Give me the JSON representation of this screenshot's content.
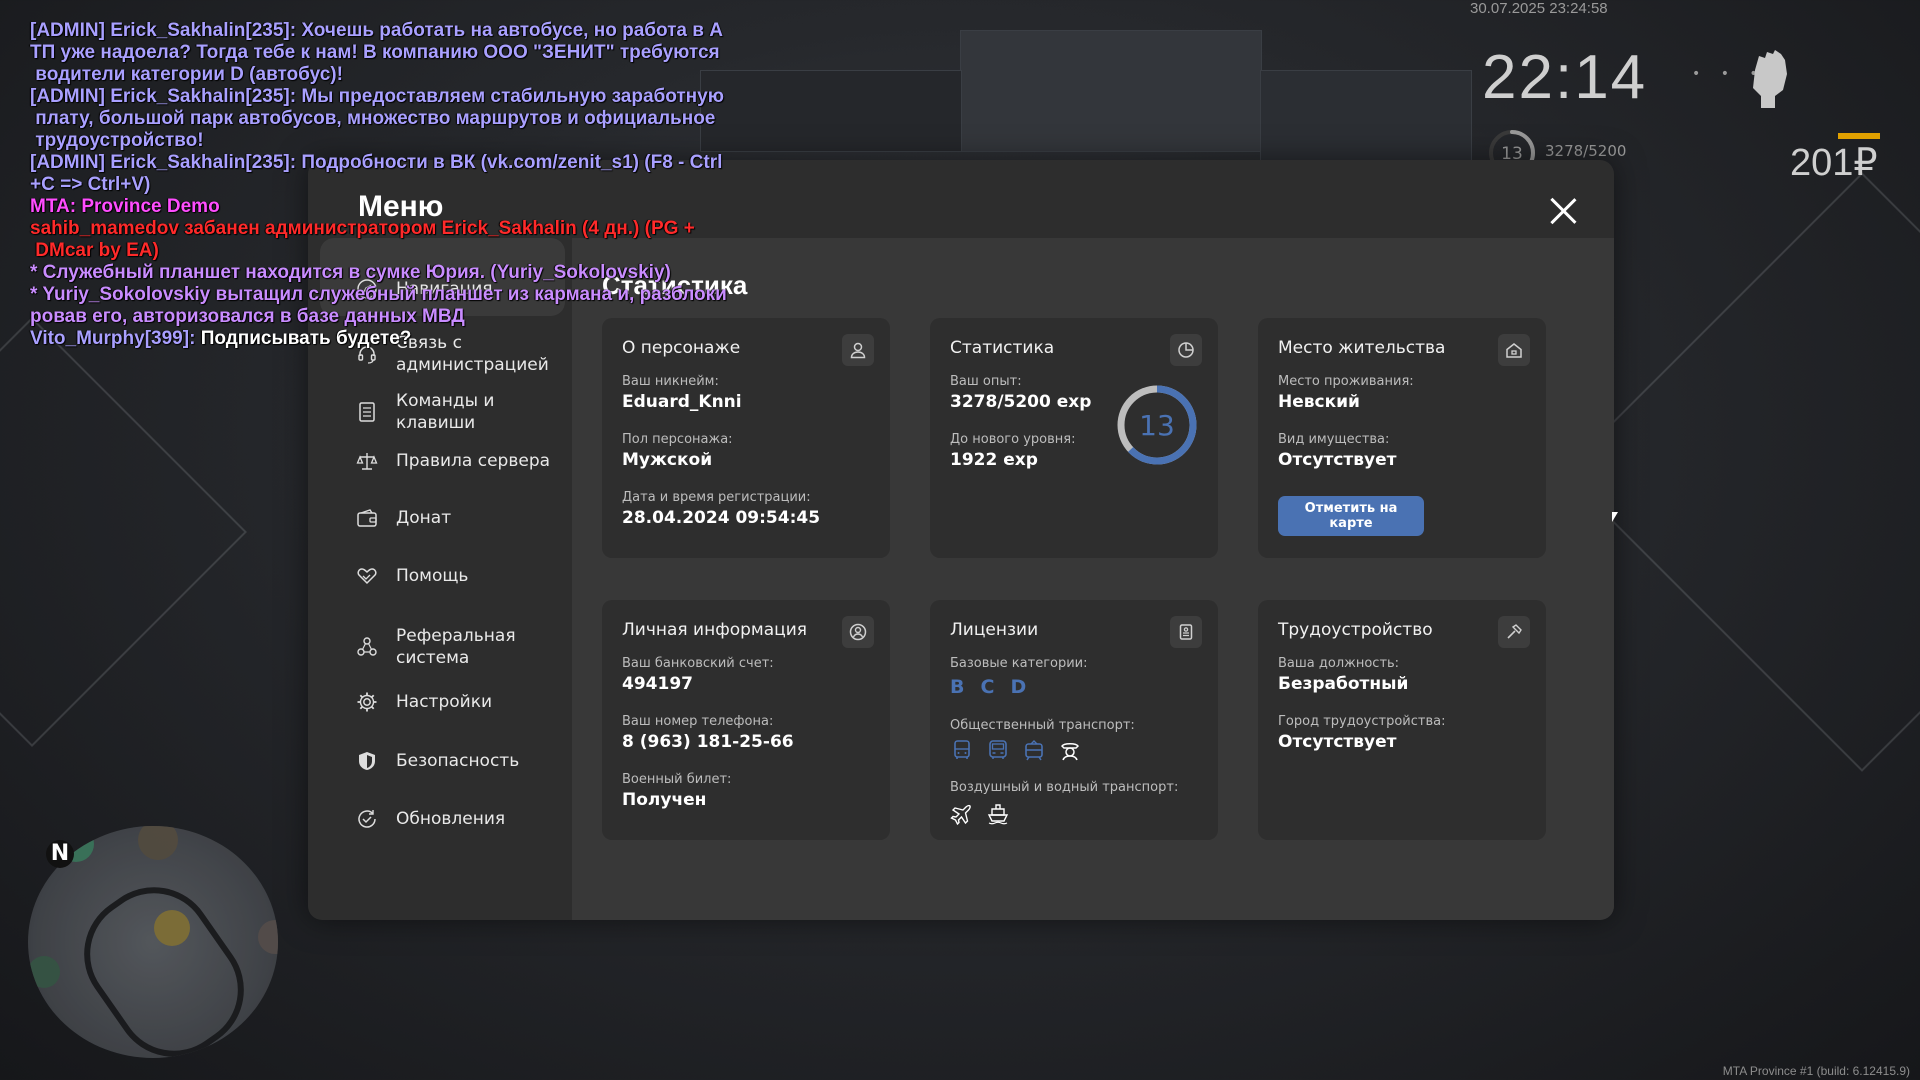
{
  "chat": [
    {
      "segments": [
        {
          "text": "[ADMIN] Erick_Sakhalin[235]: Хочешь работать на автобусе, но работа в А",
          "color": "#a9a0ff"
        }
      ]
    },
    {
      "segments": [
        {
          "text": "ТП уже надоела? Тогда тебе к нам! В компанию ООО \"ЗЕНИТ\" требуются",
          "color": "#a9a0ff"
        }
      ]
    },
    {
      "segments": [
        {
          "text": " водители категории D (автобус)!",
          "color": "#a9a0ff"
        }
      ]
    },
    {
      "segments": [
        {
          "text": "[ADMIN] Erick_Sakhalin[235]: Мы предоставляем стабильную заработную",
          "color": "#a9a0ff"
        }
      ]
    },
    {
      "segments": [
        {
          "text": " плату, большой парк автобусов, множество маршрутов и официальное",
          "color": "#a9a0ff"
        }
      ]
    },
    {
      "segments": [
        {
          "text": " трудоустройство!",
          "color": "#a9a0ff"
        }
      ]
    },
    {
      "segments": [
        {
          "text": "[ADMIN] Erick_Sakhalin[235]: Подробности в ВК (vk.com/zenit_s1) (F8 - Ctrl",
          "color": "#a9a0ff"
        }
      ]
    },
    {
      "segments": [
        {
          "text": "+C => Ctrl+V)",
          "color": "#a9a0ff"
        }
      ]
    },
    {
      "segments": [
        {
          "text": "MTA: Province Demo",
          "color": "#ff4dff"
        }
      ]
    },
    {
      "segments": [
        {
          "text": "sahib_mamedov забанен администратором Erick_Sakhalin (4 дн.) (PG +",
          "color": "#ff2a2a"
        }
      ]
    },
    {
      "segments": [
        {
          "text": " DMcar by EA)",
          "color": "#ff2a2a"
        }
      ]
    },
    {
      "segments": [
        {
          "text": "* Служебный планшет находится в сумке Юрия. (Yuriy_Sokolovskiy)",
          "color": "#c98cff"
        }
      ]
    },
    {
      "segments": [
        {
          "text": "* Yuriy_Sokolovskiy вытащил служебный планшет из кармана и, разблоки",
          "color": "#c98cff"
        }
      ]
    },
    {
      "segments": [
        {
          "text": "ровав его, авторизовался в базе данных МВД",
          "color": "#c98cff"
        }
      ]
    },
    {
      "segments": [
        {
          "text": "Vito_Murphy[399]: ",
          "color": "#a9a0ff"
        },
        {
          "text": "Подписывать будете?",
          "color": "#ffffff"
        }
      ]
    }
  ],
  "hud": {
    "date": "30.07.2025 23:24:58",
    "time": "22:14",
    "level": "13",
    "exp": "3278/5200",
    "money": "201₽",
    "dots": "• • •"
  },
  "footer": {
    "build": "MTA Province #1 (build: 6.12415.9)"
  },
  "minimap": {
    "north": "N"
  },
  "menu": {
    "title": "Меню",
    "content_title": "Статистика",
    "sidebar": [
      {
        "id": "navigation",
        "label": "Навигация",
        "icon": "compass-icon"
      },
      {
        "id": "admin-contact",
        "label": "Связь с администрацией",
        "icon": "headset-icon"
      },
      {
        "id": "commands",
        "label": "Команды и клавиши",
        "icon": "document-icon"
      },
      {
        "id": "rules",
        "label": "Правила сервера",
        "icon": "scales-icon"
      },
      {
        "id": "donate",
        "label": "Донат",
        "icon": "wallet-icon"
      },
      {
        "id": "help",
        "label": "Помощь",
        "icon": "handshake-heart-icon"
      },
      {
        "id": "referral",
        "label": "Реферальная система",
        "icon": "people-network-icon"
      },
      {
        "id": "settings",
        "label": "Настройки",
        "icon": "gear-icon"
      },
      {
        "id": "security",
        "label": "Безопасность",
        "icon": "shield-icon"
      },
      {
        "id": "updates",
        "label": "Обновления",
        "icon": "refresh-check-icon"
      }
    ],
    "cards": {
      "character": {
        "title": "О персонаже",
        "icon": "user-icon",
        "nick_label": "Ваш никнейм:",
        "nick": "Eduard_Knni",
        "gender_label": "Пол персонажа:",
        "gender": "Мужской",
        "reg_label": "Дата и время регистрации:",
        "reg": "28.04.2024 09:54:45"
      },
      "stats": {
        "title": "Статистика",
        "icon": "pie-chart-icon",
        "exp_label": "Ваш опыт:",
        "exp": "3278/5200 exp",
        "next_label": "До нового уровня:",
        "next": "1922 exp",
        "level": "13",
        "progress": 0.63
      },
      "residence": {
        "title": "Место жительства",
        "icon": "house-icon",
        "place_label": "Место проживания:",
        "place": "Невский",
        "property_label": "Вид имущества:",
        "property": "Отсутствует",
        "map_button": "Отметить на карте"
      },
      "personal": {
        "title": "Личная информация",
        "icon": "user-circle-icon",
        "bank_label": "Ваш банковский счет:",
        "bank": "494197",
        "phone_label": "Ваш номер телефона:",
        "phone": "8 (963) 181-25-66",
        "military_label": "Военный билет:",
        "military": "Получен"
      },
      "licenses": {
        "title": "Лицензии",
        "icon": "id-badge-icon",
        "base_label": "Базовые категории:",
        "base": [
          "B",
          "C",
          "D"
        ],
        "public_label": "Общественный транспорт:",
        "public_icons": [
          "bus-icon",
          "bus-front-icon",
          "tram-icon",
          "taxi-driver-icon"
        ],
        "air_label": "Воздушный и водный транспорт:",
        "air_icons": [
          "airplane-icon",
          "ship-icon"
        ]
      },
      "job": {
        "title": "Трудоустройство",
        "icon": "hammer-icon",
        "position_label": "Ваша должность:",
        "position": "Безработный",
        "city_label": "Город трудоустройства:",
        "city": "Отсутствует"
      }
    }
  },
  "colors": {
    "accent": "#4a72b3",
    "panel": "#2d2d2d",
    "content": "#383838",
    "card": "#2e2e2e"
  }
}
